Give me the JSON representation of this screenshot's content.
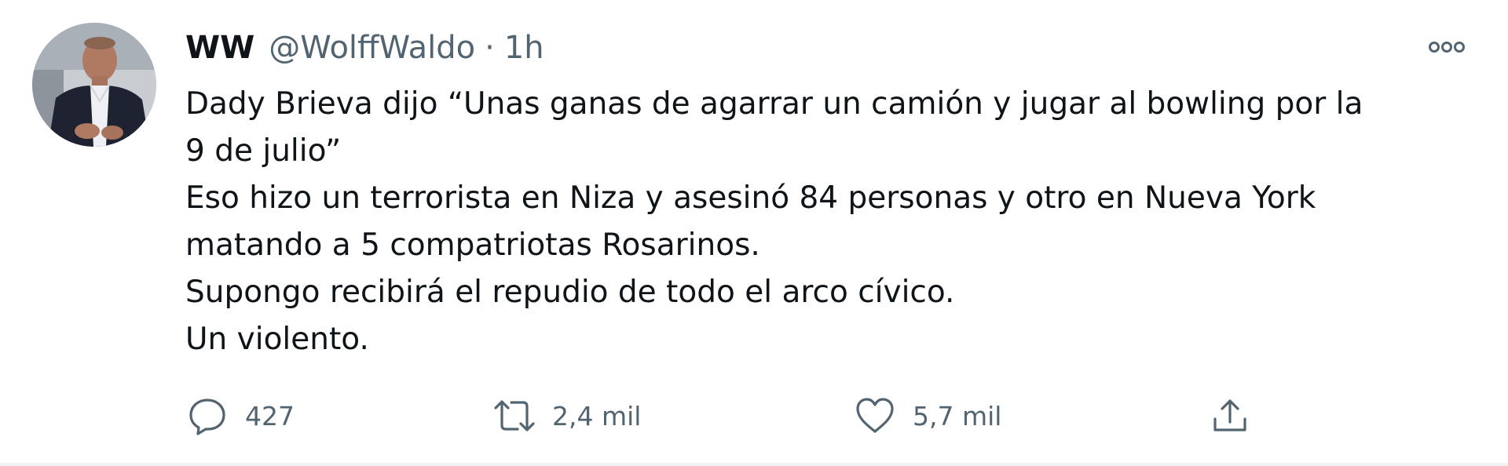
{
  "tweet": {
    "author": {
      "display_name": "WW",
      "handle": "@WolffWaldo",
      "separator": "·",
      "time": "1h"
    },
    "text_lines": [
      "Dady Brieva dijo “Unas ganas de agarrar un camión y jugar al bowling por la",
      "9 de julio”",
      "Eso hizo un terrorista en Niza y asesinó 84 personas y otro en Nueva York",
      "matando a 5 compatriotas Rosarinos.",
      "Supongo recibirá el repudio de todo el arco cívico.",
      "Un violento."
    ],
    "actions": {
      "reply": {
        "icon": "reply-icon",
        "count": "427"
      },
      "retweet": {
        "icon": "retweet-icon",
        "count": "2,4 mil"
      },
      "like": {
        "icon": "heart-icon",
        "count": "5,7 mil"
      },
      "share": {
        "icon": "share-icon"
      }
    },
    "more_icon": "more-options-icon"
  },
  "colors": {
    "text_primary": "#0f1419",
    "text_secondary": "#536471",
    "background": "#ffffff",
    "divider": "#eff3f4"
  }
}
